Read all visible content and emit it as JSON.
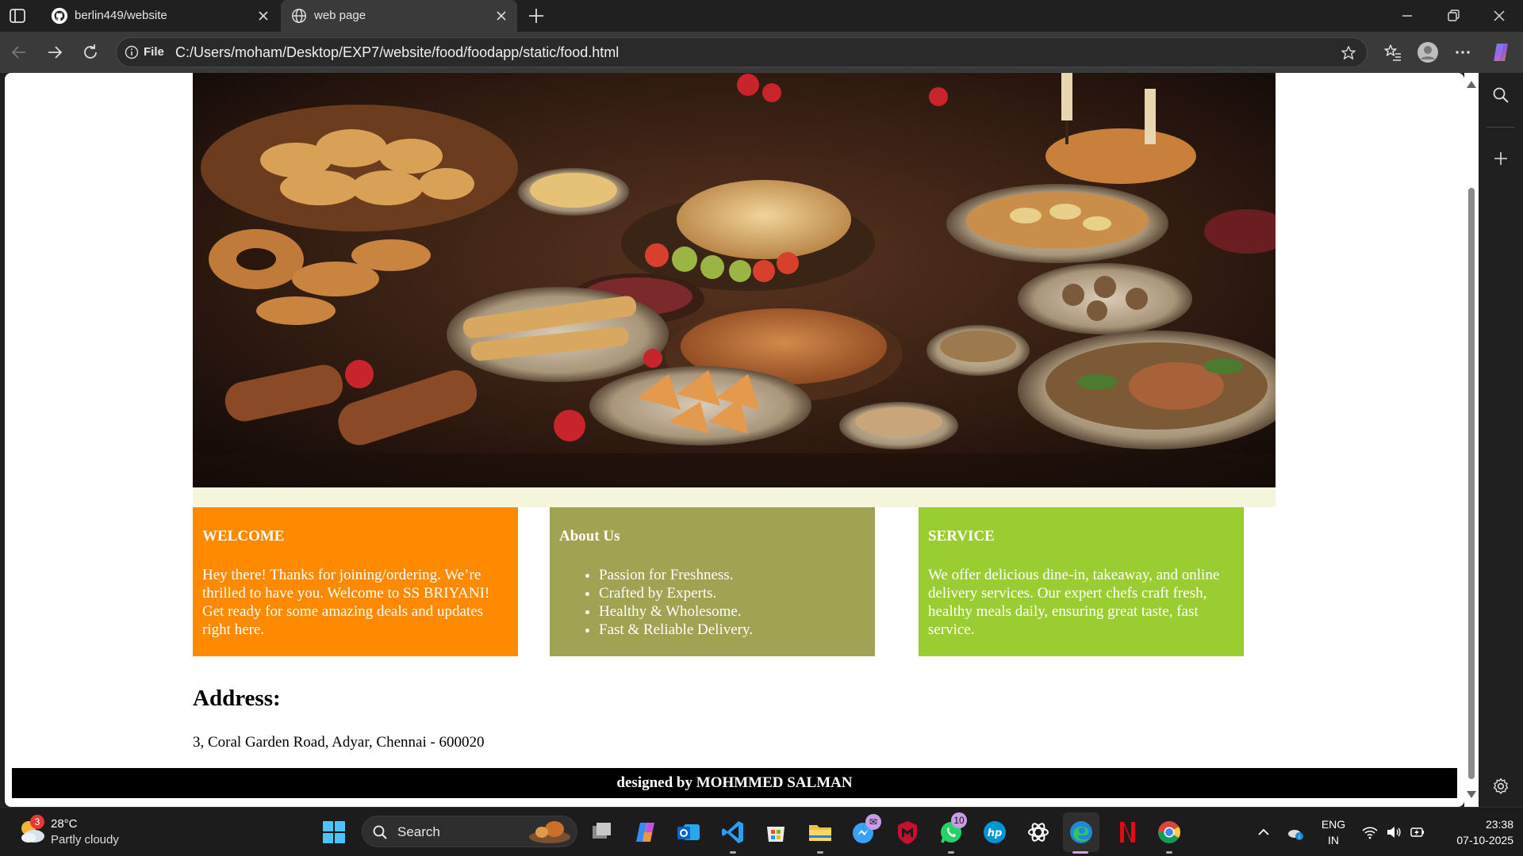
{
  "browser": {
    "tabs": [
      {
        "label": "berlin449/website",
        "icon": "github-icon",
        "active": false
      },
      {
        "label": "web page",
        "icon": "globe-icon",
        "active": true
      }
    ],
    "address": {
      "chip": "File",
      "url": "C:/Users/moham/Desktop/EXP7/website/food/foodapp/static/food.html"
    }
  },
  "page": {
    "hero_alt": "food spread",
    "cards": {
      "welcome": {
        "title": "WELCOME",
        "text": "Hey there! Thanks for joining/ordering. We’re thrilled to have you. Welcome to SS BRIYANI! Get ready for some amazing deals and updates right here."
      },
      "about": {
        "title": "About Us",
        "items": [
          "Passion for Freshness.",
          "Crafted by Experts.",
          "Healthy & Wholesome.",
          "Fast & Reliable Delivery."
        ]
      },
      "service": {
        "title": "SERVICE",
        "text": "We offer delicious dine-in, takeaway, and online delivery services. Our expert chefs craft fresh, healthy meals daily, ensuring great taste, fast service."
      }
    },
    "address": {
      "title": "Address:",
      "text": "3, Coral Garden Road, Adyar, Chennai - 600020"
    },
    "footer": {
      "prefix": "designed by ",
      "name": "MOHMMED SALMAN"
    },
    "colors": {
      "welcome": "#ff8a00",
      "about": "#a0a352",
      "service": "#9acd32",
      "band": "#f5f5dc"
    }
  },
  "taskbar": {
    "weather": {
      "temp": "28°C",
      "desc": "Partly cloudy",
      "badge": "3"
    },
    "search_label": "Search",
    "apps": [
      "file-explorer-icon",
      "copilot-icon",
      "outlook-icon",
      "vscode-icon",
      "store-icon",
      "folder-icon",
      "messenger-icon",
      "mcafee-icon",
      "whatsapp-icon",
      "hp-icon",
      "chatgpt-icon",
      "edge-icon",
      "netflix-icon",
      "chrome-icon"
    ],
    "badges": {
      "messenger": "",
      "whatsapp": "10"
    },
    "tray": {
      "lang_top": "ENG",
      "lang_bottom": "IN",
      "time": "23:38",
      "date": "07-10-2025"
    }
  }
}
